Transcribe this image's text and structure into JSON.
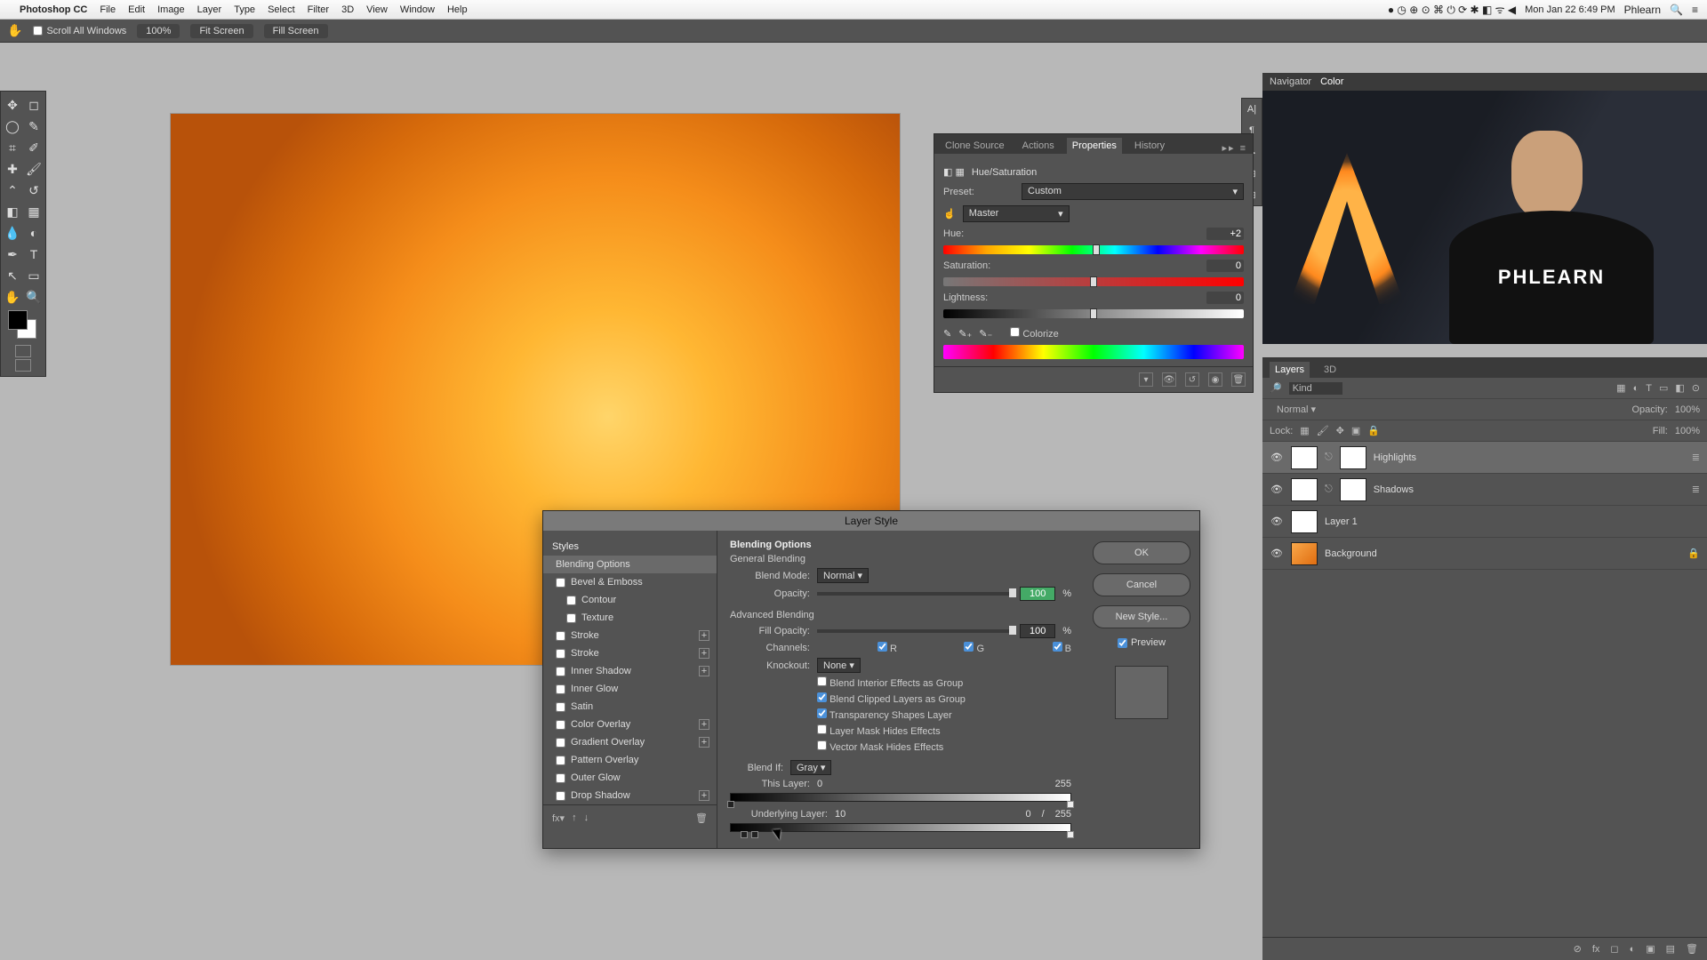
{
  "menubar": {
    "app": "Photoshop CC",
    "items": [
      "File",
      "Edit",
      "Image",
      "Layer",
      "Type",
      "Select",
      "Filter",
      "3D",
      "View",
      "Window",
      "Help"
    ],
    "clock": "Mon Jan 22  6:49 PM",
    "user": "Phlearn"
  },
  "optionsbar": {
    "scroll_all": "Scroll All Windows",
    "zoom": "100%",
    "fit": "Fit Screen",
    "fill": "Fill Screen"
  },
  "properties": {
    "tabs": [
      "Clone Source",
      "Actions",
      "Properties",
      "History"
    ],
    "active_tab": "Properties",
    "adj_title": "Hue/Saturation",
    "preset_label": "Preset:",
    "preset_value": "Custom",
    "channel_value": "Master",
    "hue_label": "Hue:",
    "hue_value": "+2",
    "sat_label": "Saturation:",
    "sat_value": "0",
    "light_label": "Lightness:",
    "light_value": "0",
    "colorize": "Colorize"
  },
  "layerstyle": {
    "title": "Layer Style",
    "styles_head": "Styles",
    "active_item": "Blending Options",
    "effects": [
      "Bevel & Emboss",
      "Contour",
      "Texture",
      "Stroke",
      "Stroke",
      "Inner Shadow",
      "Inner Glow",
      "Satin",
      "Color Overlay",
      "Gradient Overlay",
      "Pattern Overlay",
      "Outer Glow",
      "Drop Shadow"
    ],
    "effect_has_plus": {
      "Stroke": true,
      "Inner Shadow": true,
      "Color Overlay": true,
      "Gradient Overlay": true,
      "Drop Shadow": true
    },
    "section_blending": "Blending Options",
    "section_general": "General Blending",
    "blendmode_label": "Blend Mode:",
    "blendmode_value": "Normal",
    "opacity_label": "Opacity:",
    "opacity_value": "100",
    "pct": "%",
    "section_adv": "Advanced Blending",
    "fillopacity_label": "Fill Opacity:",
    "fillopacity_value": "100",
    "channels_label": "Channels:",
    "ch_r": "R",
    "ch_g": "G",
    "ch_b": "B",
    "knockout_label": "Knockout:",
    "knockout_value": "None",
    "cb1": "Blend Interior Effects as Group",
    "cb2": "Blend Clipped Layers as Group",
    "cb3": "Transparency Shapes Layer",
    "cb4": "Layer Mask Hides Effects",
    "cb5": "Vector Mask Hides Effects",
    "blendif_label": "Blend If:",
    "blendif_value": "Gray",
    "thislayer_label": "This Layer:",
    "thislayer_lo": "0",
    "thislayer_hi": "255",
    "under_label": "Underlying Layer:",
    "under_lo": "10",
    "under_mid": "0",
    "under_sep": "/",
    "under_hi": "255",
    "btn_ok": "OK",
    "btn_cancel": "Cancel",
    "btn_newstyle": "New Style...",
    "preview": "Preview"
  },
  "minitabs": {
    "navigator": "Navigator",
    "color": "Color"
  },
  "video": {
    "shirt": "PHLEARN"
  },
  "layers": {
    "tab_layers": "Layers",
    "tab_3d": "3D",
    "kind": "Kind",
    "mode": "Normal",
    "opacity_label": "Opacity:",
    "opacity_value": "100%",
    "lock_label": "Lock:",
    "fill_label": "Fill:",
    "fill_value": "100%",
    "items": [
      {
        "name": "Highlights",
        "has_mask": true,
        "has_fx": true,
        "thumb": "white"
      },
      {
        "name": "Shadows",
        "has_mask": true,
        "has_fx": true,
        "thumb": "white"
      },
      {
        "name": "Layer 1",
        "has_mask": false,
        "has_fx": false,
        "thumb": "white"
      },
      {
        "name": "Background",
        "has_mask": false,
        "has_fx": false,
        "thumb": "rose",
        "locked": true
      }
    ]
  }
}
